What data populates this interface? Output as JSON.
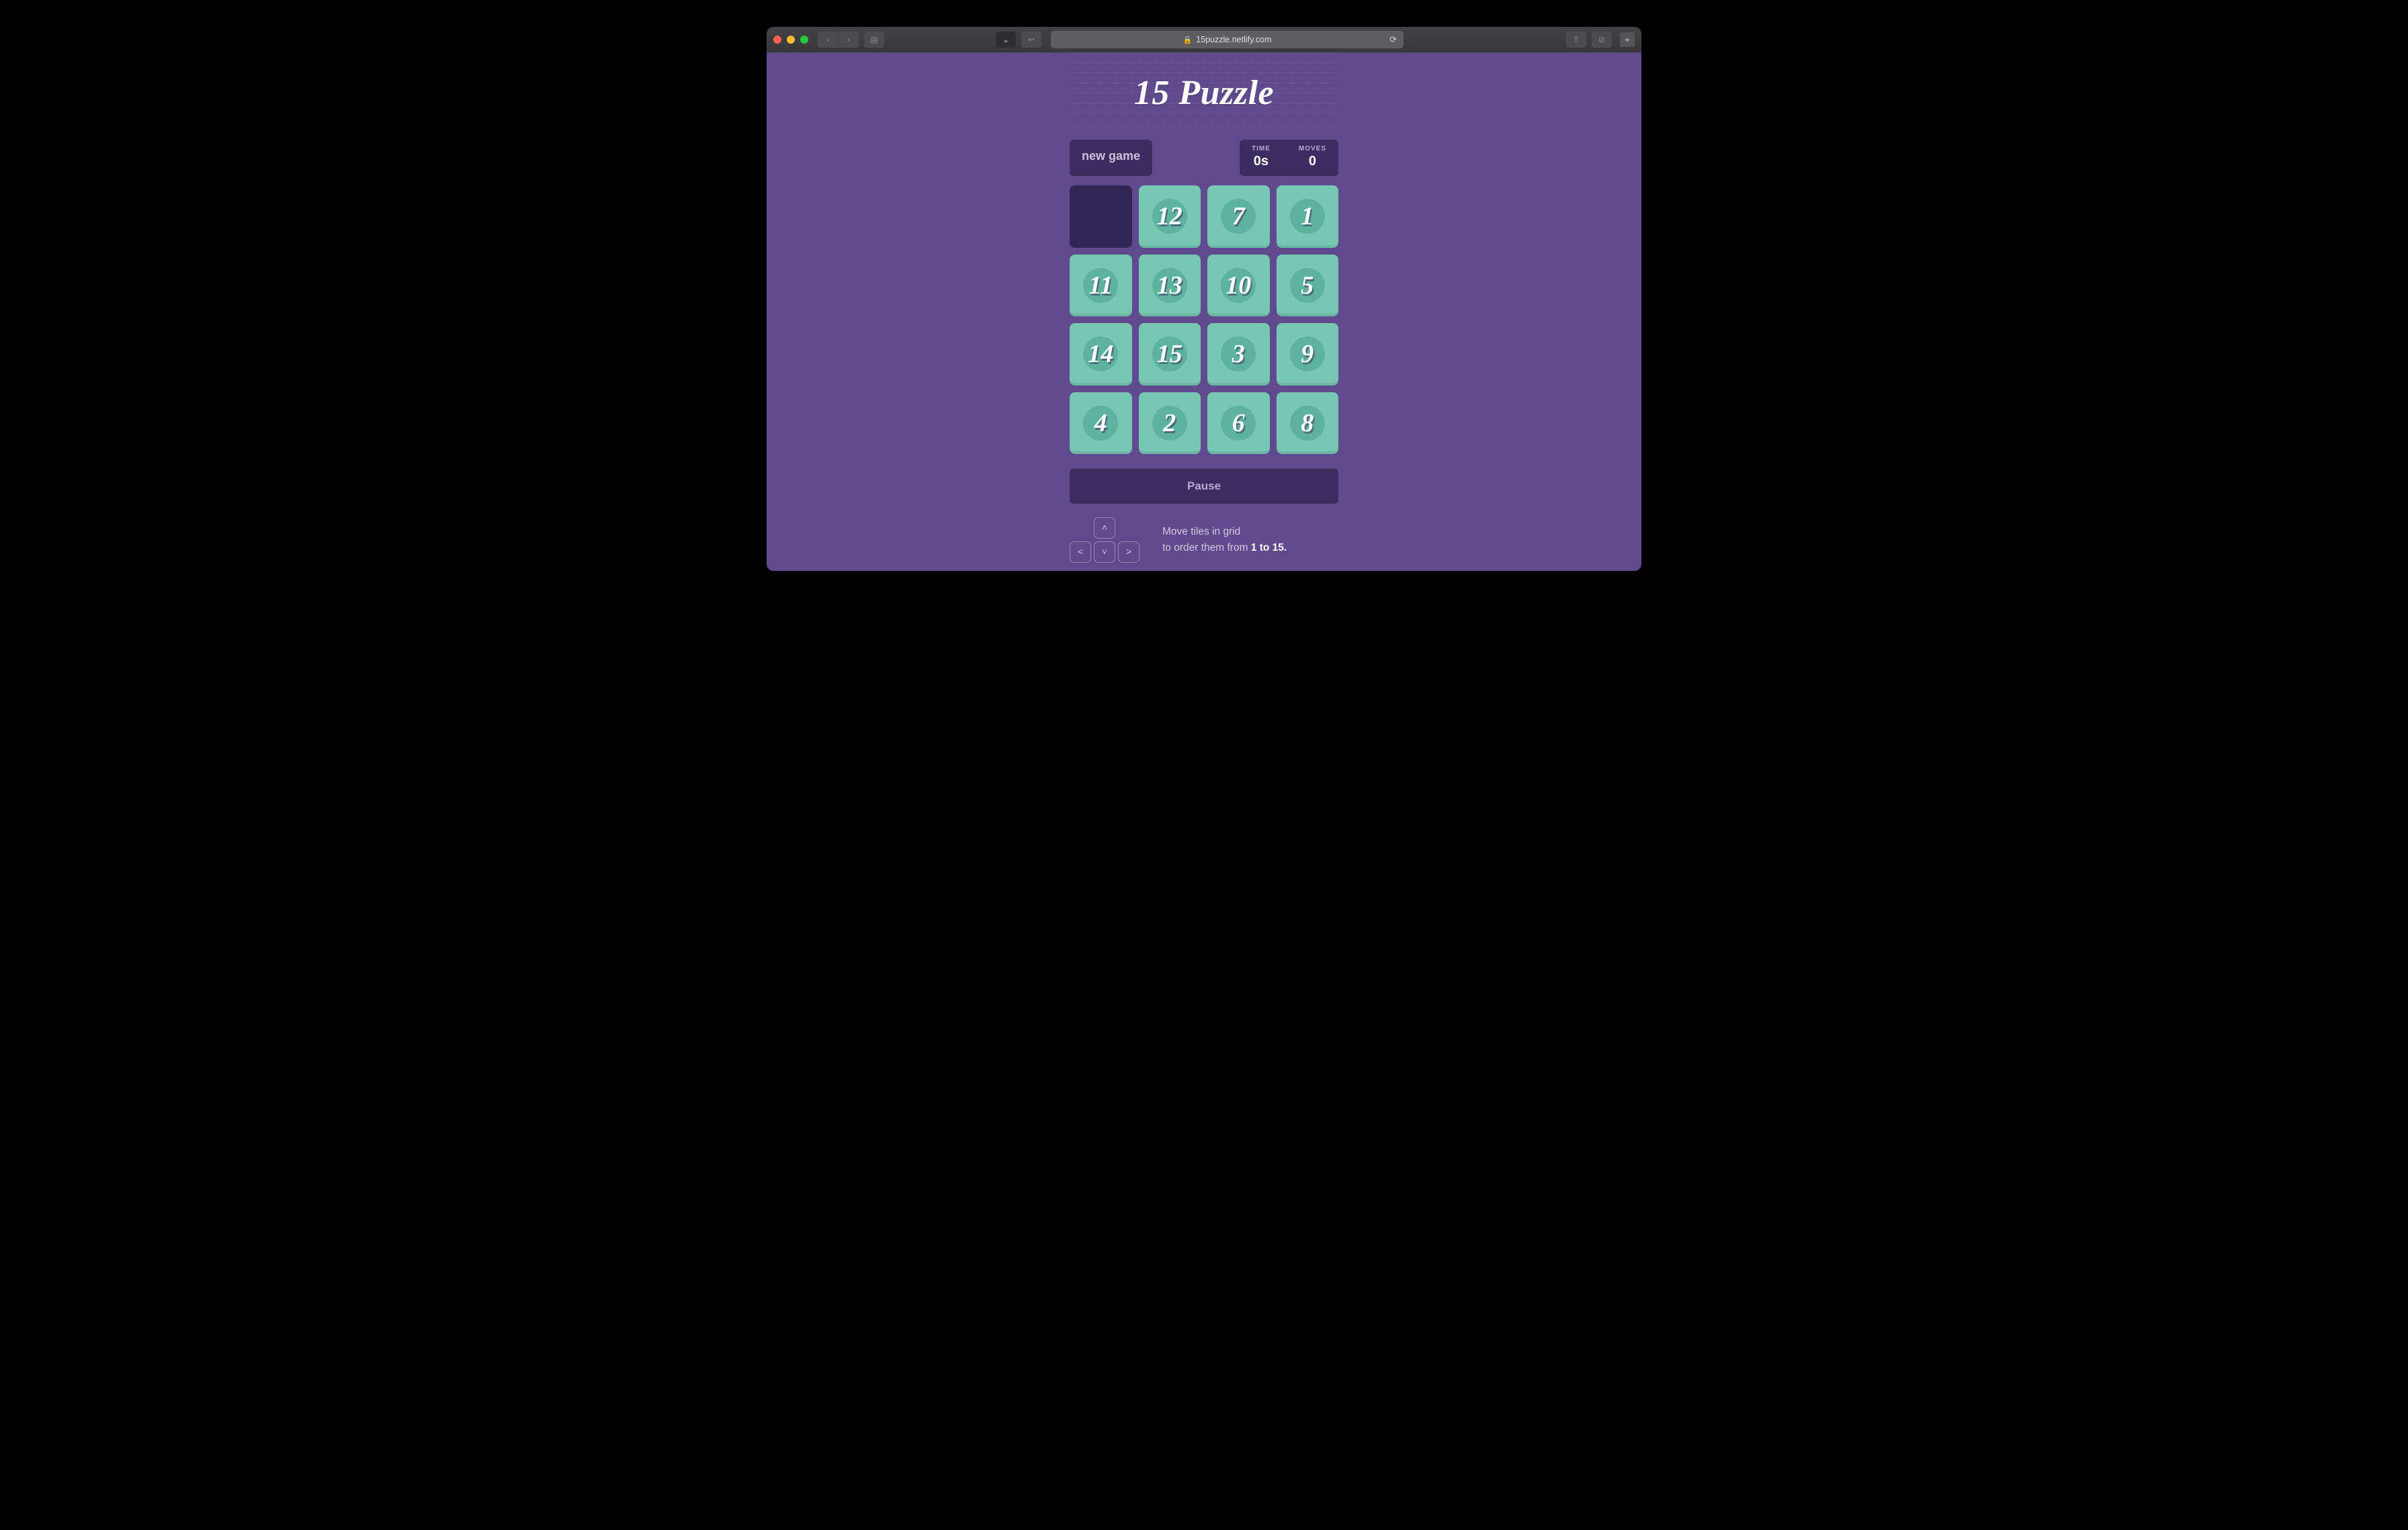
{
  "browser": {
    "url_host": "15puzzle.netlify.com",
    "icons": {
      "back": "‹",
      "forward": "›",
      "sidebar": "▤",
      "pocket": "⌄",
      "bookmark": "↩",
      "lock": "🔒",
      "reload": "⟳",
      "share": "⇧",
      "tabs": "⧉",
      "plus": "+"
    }
  },
  "game": {
    "title": "15 Puzzle",
    "new_game_label": "new game",
    "stats": {
      "time_label": "TIME",
      "time_value": "0s",
      "moves_label": "MOVES",
      "moves_value": "0"
    },
    "grid": [
      null,
      12,
      7,
      1,
      11,
      13,
      10,
      5,
      14,
      15,
      3,
      9,
      4,
      2,
      6,
      8
    ],
    "pause_label": "Pause",
    "instructions_line1": "Move tiles in grid",
    "instructions_line2_pre": "to order them from ",
    "instructions_line2_bold": "1 to 15."
  }
}
